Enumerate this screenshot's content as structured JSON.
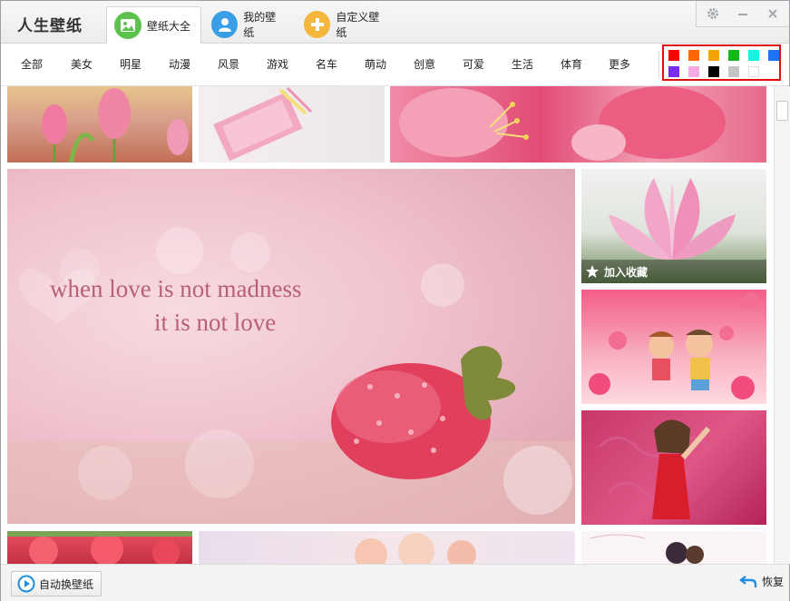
{
  "app": {
    "title": "人生壁纸"
  },
  "tabs": [
    {
      "label": "壁纸大全",
      "icon": "wallpaper-icon",
      "color": "#5cc24d",
      "active": true
    },
    {
      "label": "我的壁纸",
      "icon": "user-icon",
      "color": "#3a9ee6",
      "active": false
    },
    {
      "label": "自定义壁纸",
      "icon": "plus-icon",
      "color": "#f4b63c",
      "active": false
    }
  ],
  "window_controls": [
    "gear-icon",
    "minimize-icon",
    "close-icon"
  ],
  "categories": [
    "全部",
    "美女",
    "明星",
    "动漫",
    "风景",
    "游戏",
    "名车",
    "萌动",
    "创意",
    "可爱",
    "生活",
    "体育",
    "更多"
  ],
  "palette": {
    "colors": [
      "#ff0000",
      "#ff6600",
      "#f5a300",
      "#11b81a",
      "#13f4e3",
      "#1b74f2",
      "#7a2bf5",
      "#f6a9e2",
      "#000000",
      "#c4c4c4",
      "#ffffff"
    ]
  },
  "featured": {
    "line1": "when love is not madness",
    "line2": "it is not love"
  },
  "favorite": {
    "label": "加入收藏",
    "icon": "star-icon"
  },
  "footer": {
    "auto_change_label": "自动换壁纸",
    "restore_label": "恢复"
  }
}
